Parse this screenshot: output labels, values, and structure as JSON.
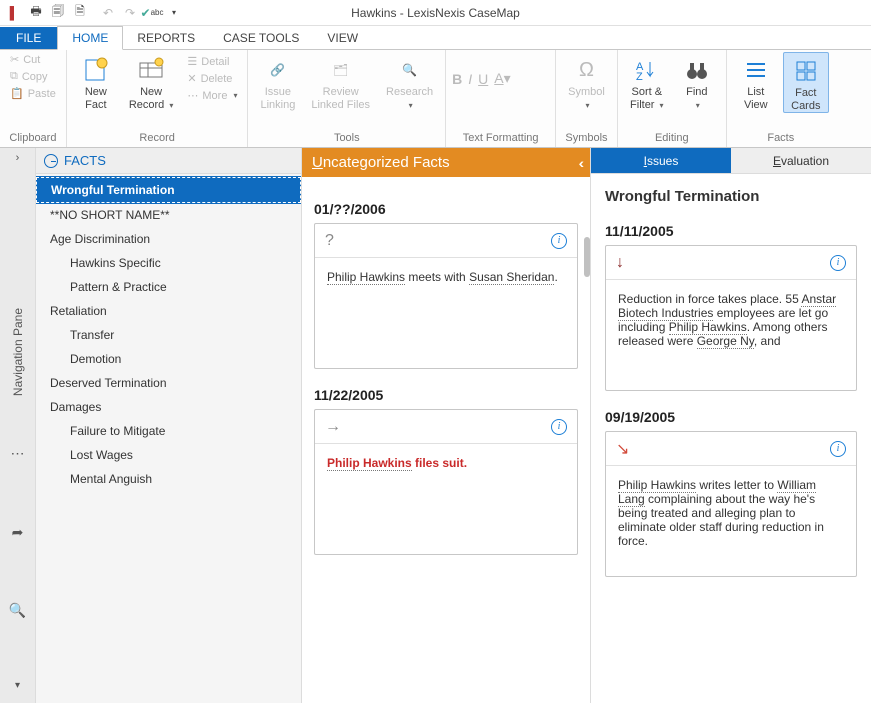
{
  "window_title": "Hawkins - LexisNexis CaseMap",
  "tabs": {
    "file": "FILE",
    "home": "HOME",
    "reports": "REPORTS",
    "case_tools": "CASE TOOLS",
    "view": "VIEW"
  },
  "ribbon": {
    "clipboard": {
      "cut": "Cut",
      "copy": "Copy",
      "paste": "Paste",
      "label": "Clipboard"
    },
    "record": {
      "new_fact": "New\nFact",
      "new_record": "New\nRecord",
      "detail": "Detail",
      "delete": "Delete",
      "more": "More",
      "label": "Record"
    },
    "tools": {
      "issue_linking": "Issue\nLinking",
      "review_linked": "Review\nLinked Files",
      "research": "Research",
      "label": "Tools"
    },
    "text_formatting": {
      "label": "Text Formatting"
    },
    "symbols": {
      "symbol": "Symbol",
      "label": "Symbols"
    },
    "editing": {
      "sort_filter": "Sort &\nFilter",
      "find": "Find",
      "label": "Editing"
    },
    "facts": {
      "list_view": "List\nView",
      "fact_cards": "Fact\nCards",
      "label": "Facts"
    }
  },
  "nav_pane_label": "Navigation Pane",
  "facts_header": "FACTS",
  "tree": {
    "items": [
      {
        "label": "Wrongful Termination",
        "level": 1,
        "selected": true
      },
      {
        "label": "**NO SHORT NAME**",
        "level": 1
      },
      {
        "label": "Age Discrimination",
        "level": 1
      },
      {
        "label": "Hawkins Specific",
        "level": 2
      },
      {
        "label": "Pattern & Practice",
        "level": 2
      },
      {
        "label": "Retaliation",
        "level": 1
      },
      {
        "label": "Transfer",
        "level": 2
      },
      {
        "label": "Demotion",
        "level": 2
      },
      {
        "label": "Deserved Termination",
        "level": 1
      },
      {
        "label": "Damages",
        "level": 1
      },
      {
        "label": "Failure to Mitigate",
        "level": 2
      },
      {
        "label": "Lost Wages",
        "level": 2
      },
      {
        "label": "Mental Anguish",
        "level": 2
      }
    ]
  },
  "uncategorized_header": "ncategorized Facts",
  "uncategorized_header_u": "U",
  "center_cards": [
    {
      "date": "01/??/2006",
      "status": "?",
      "body_plain_pre": "",
      "body_dotted_1": "Philip Hawkins",
      "body_mid": " meets with ",
      "body_dotted_2": "Susan Sheridan",
      "body_post": ".",
      "red": false
    },
    {
      "date": "11/22/2005",
      "status": "→",
      "body_plain_pre": "",
      "body_dotted_1": "Philip Hawkins",
      "body_mid": " files suit.",
      "body_dotted_2": "",
      "body_post": "",
      "red": true
    }
  ],
  "right_tabs": {
    "issues": "ssues",
    "issues_u": "I",
    "evaluation": "valuation",
    "evaluation_u": "E"
  },
  "issue_title": "Wrongful Termination",
  "right_cards": [
    {
      "date": "11/11/2005",
      "status": "↓",
      "status_class": "red-down",
      "segments": [
        {
          "t": "Reduction in force takes place.  55 ",
          "d": false
        },
        {
          "t": "Anstar Biotech Industries",
          "d": true
        },
        {
          "t": " employees are let go including ",
          "d": false
        },
        {
          "t": "Philip Hawkins",
          "d": true
        },
        {
          "t": ".  Among others released were ",
          "d": false
        },
        {
          "t": "George Ny",
          "d": true
        },
        {
          "t": ", and",
          "d": false
        }
      ]
    },
    {
      "date": "09/19/2005",
      "status": "↘",
      "status_class": "red-diag",
      "segments": [
        {
          "t": "Philip Hawkins",
          "d": true
        },
        {
          "t": " writes letter to ",
          "d": false
        },
        {
          "t": "William Lang",
          "d": true
        },
        {
          "t": " complaining about the way he's being treated and alleging plan to eliminate older staff during reduction in force.",
          "d": false
        }
      ]
    }
  ]
}
